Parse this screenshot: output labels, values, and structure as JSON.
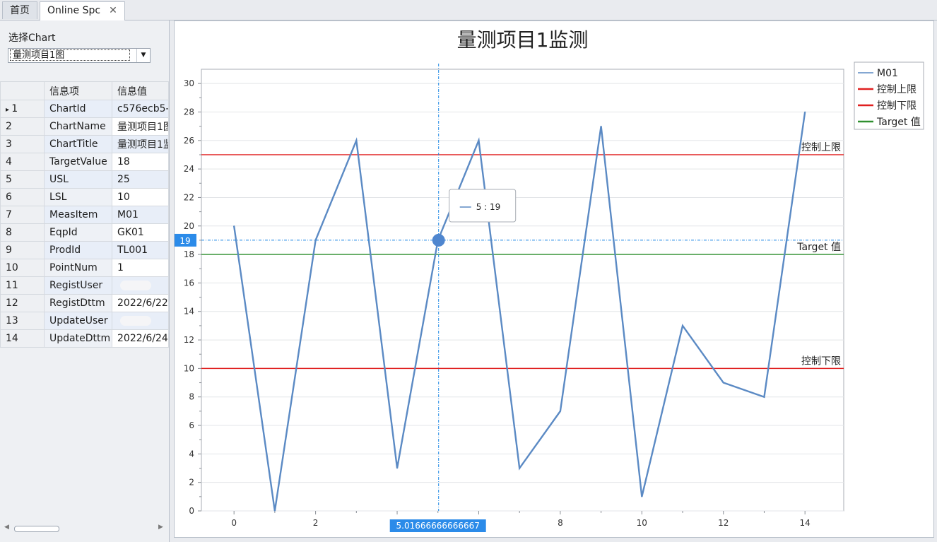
{
  "tabs": [
    {
      "label": "首页"
    },
    {
      "label": "Online Spc",
      "close": "✕"
    }
  ],
  "selector": {
    "label": "选择Chart",
    "value": "量测项目1图"
  },
  "grid": {
    "columns": [
      "信息项",
      "信息值"
    ],
    "rows": [
      {
        "n": "1",
        "item": "ChartId",
        "value": "c576ecb5-"
      },
      {
        "n": "2",
        "item": "ChartName",
        "value": "量测项目1图"
      },
      {
        "n": "3",
        "item": "ChartTitle",
        "value": "量测项目1监"
      },
      {
        "n": "4",
        "item": "TargetValue",
        "value": "18"
      },
      {
        "n": "5",
        "item": "USL",
        "value": "25"
      },
      {
        "n": "6",
        "item": "LSL",
        "value": "10"
      },
      {
        "n": "7",
        "item": "MeasItem",
        "value": "M01"
      },
      {
        "n": "8",
        "item": "EqpId",
        "value": "GK01"
      },
      {
        "n": "9",
        "item": "ProdId",
        "value": "TL001"
      },
      {
        "n": "10",
        "item": "PointNum",
        "value": "1"
      },
      {
        "n": "11",
        "item": "RegistUser",
        "value": ""
      },
      {
        "n": "12",
        "item": "RegistDttm",
        "value": "2022/6/22"
      },
      {
        "n": "13",
        "item": "UpdateUser",
        "value": ""
      },
      {
        "n": "14",
        "item": "UpdateDttm",
        "value": "2022/6/24"
      }
    ]
  },
  "chart_data": {
    "type": "line",
    "title": "量测项目1监测",
    "x": [
      0,
      1,
      2,
      3,
      4,
      5,
      6,
      7,
      8,
      9,
      10,
      11,
      12,
      13,
      14
    ],
    "series": [
      {
        "name": "M01",
        "values": [
          20,
          0,
          19,
          26,
          3,
          19,
          26,
          3,
          7,
          27,
          1,
          13,
          9,
          8,
          28
        ],
        "color": "#5b8ac4"
      }
    ],
    "reference_lines": [
      {
        "name": "控制上限",
        "value": 25,
        "color": "#e02020",
        "label": "控制上限"
      },
      {
        "name": "控制下限",
        "value": 10,
        "color": "#e02020",
        "label": "控制下限"
      },
      {
        "name": "Target 值",
        "value": 18,
        "color": "#2f8f2f",
        "label": "Target 值"
      }
    ],
    "xlim": [
      -0.8,
      14.95
    ],
    "ylim": [
      0,
      31
    ],
    "xticks": [
      0,
      2,
      4,
      6,
      8,
      10,
      12,
      14
    ],
    "yticks": [
      0,
      2,
      4,
      6,
      8,
      10,
      12,
      14,
      16,
      18,
      20,
      22,
      24,
      26,
      28,
      30
    ],
    "grid": true,
    "legend": "right-top",
    "crosshair": {
      "x": 5.01666666666667,
      "y": 19,
      "x_label": "5.01666666666667",
      "y_label": "19",
      "tooltip": "5 : 19"
    }
  }
}
